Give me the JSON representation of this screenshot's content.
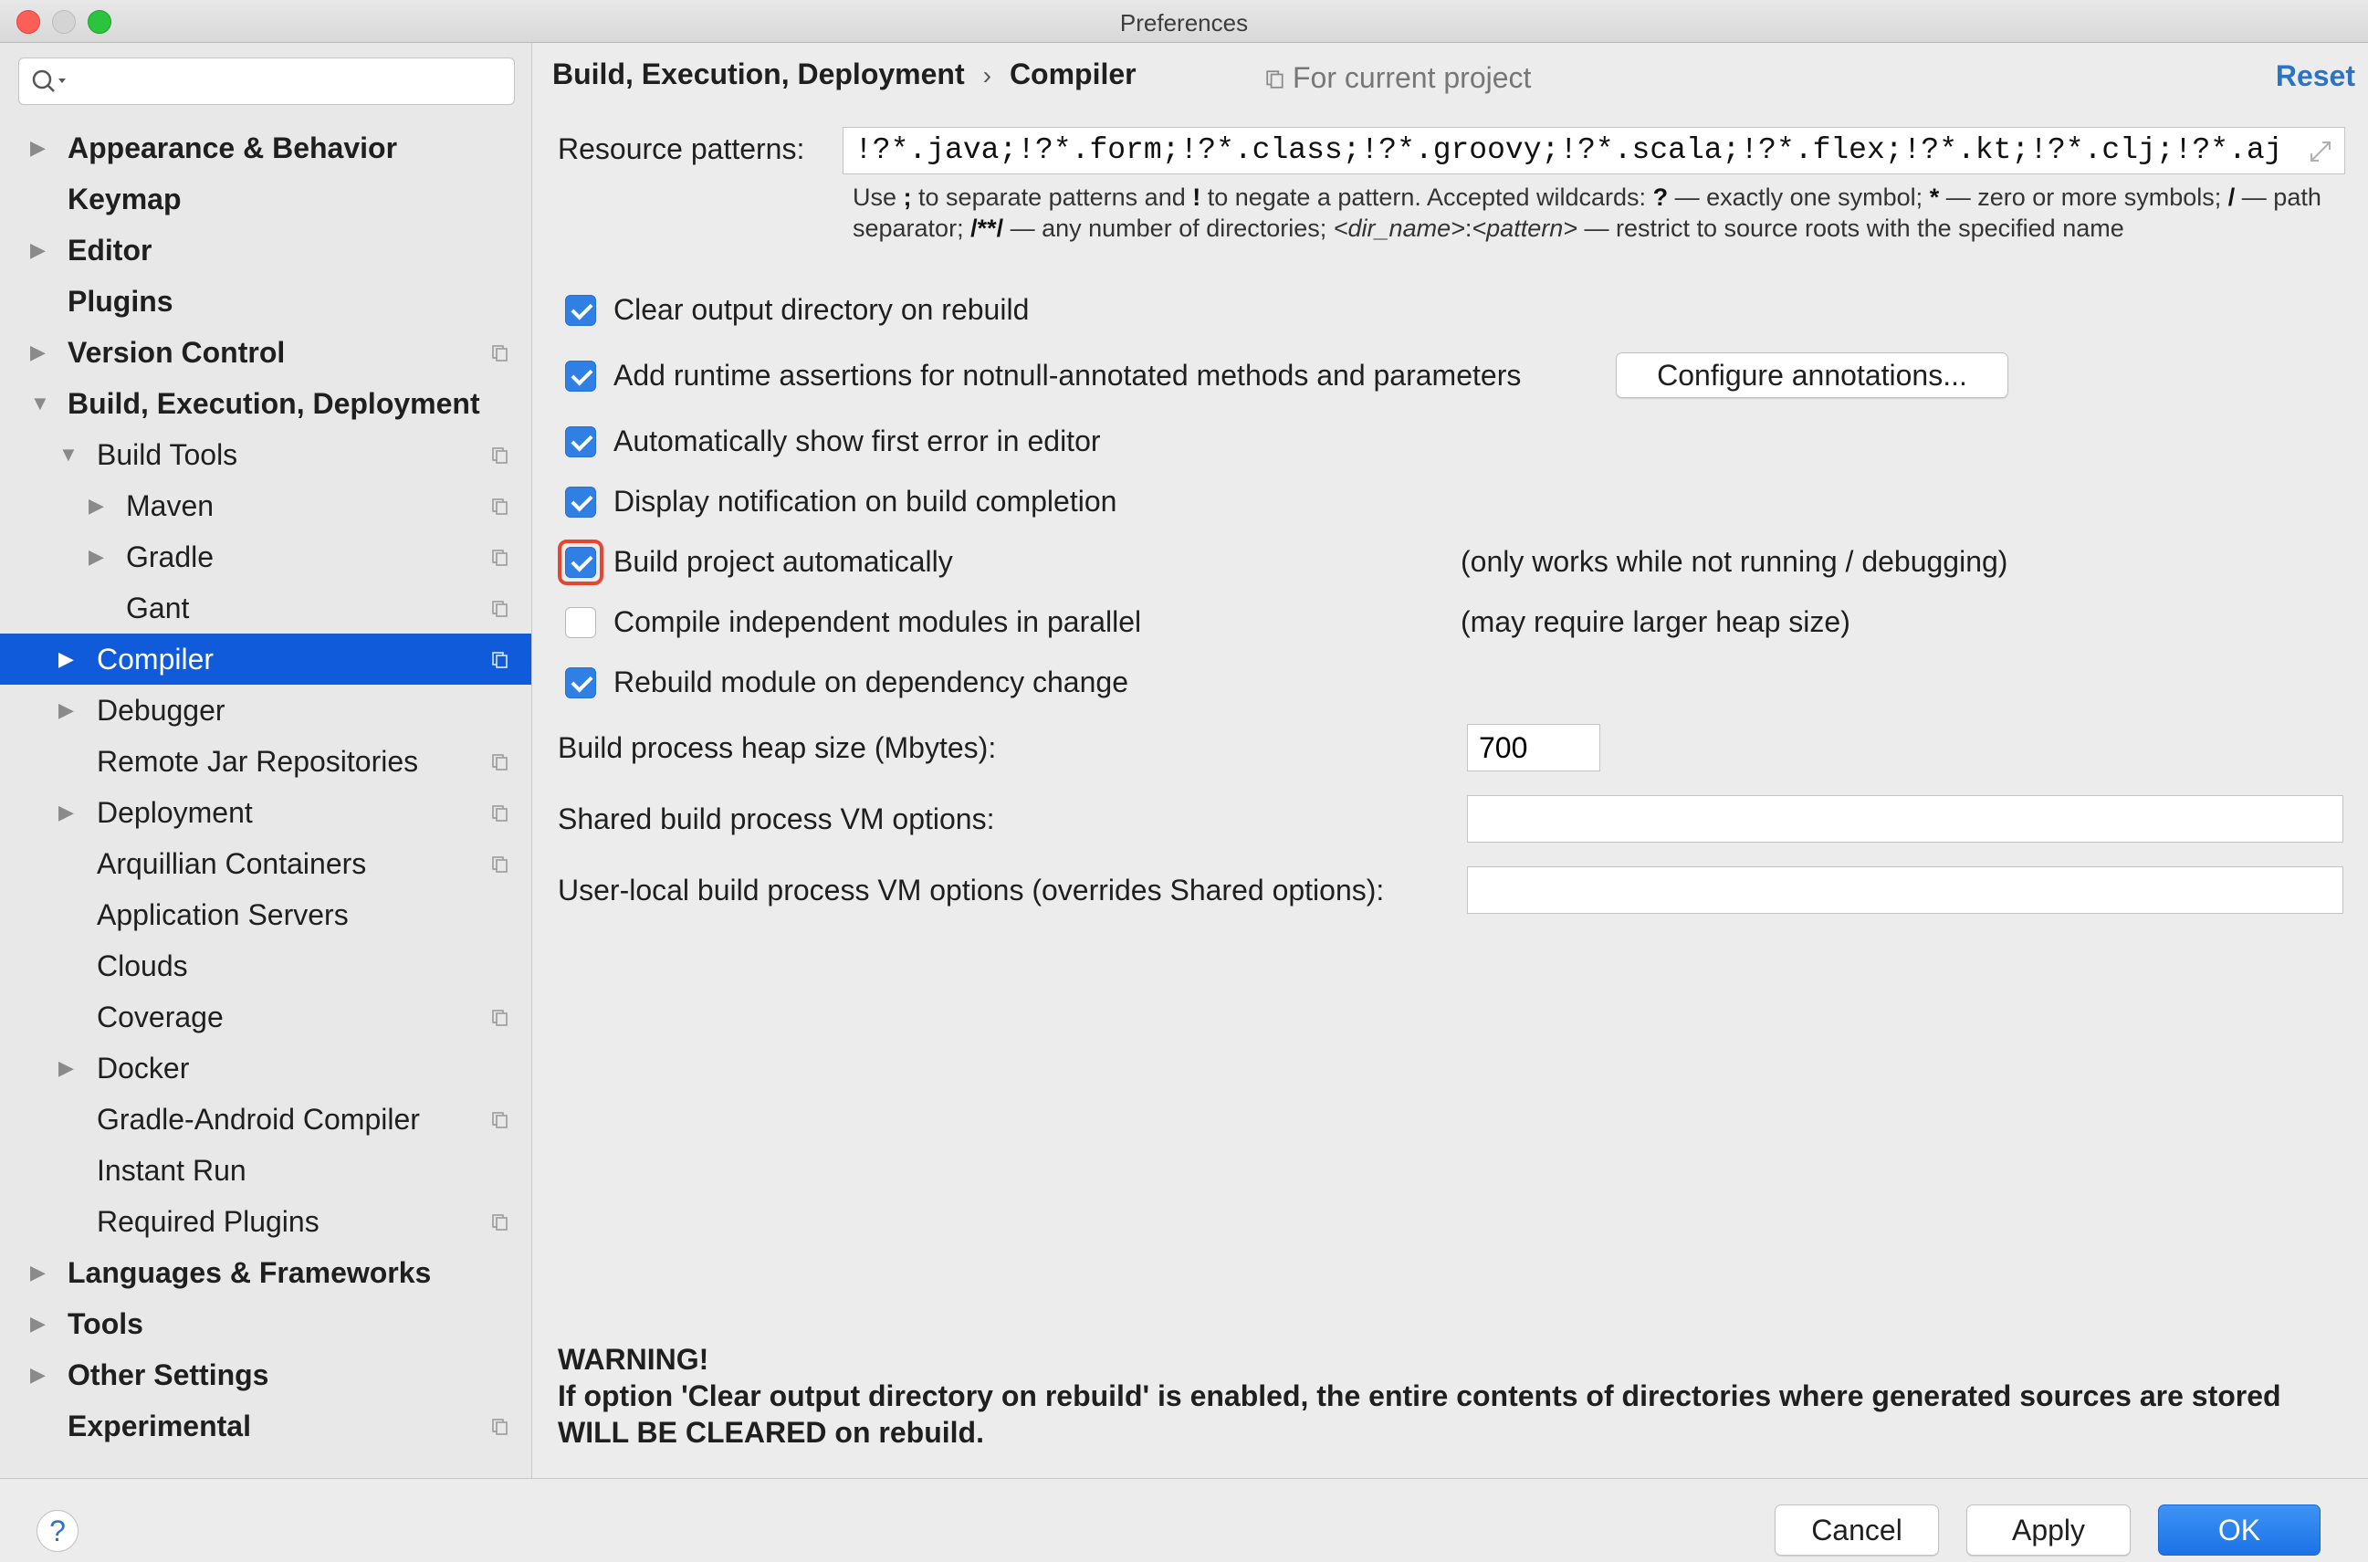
{
  "window": {
    "title": "Preferences"
  },
  "sidebar": {
    "search_placeholder": "",
    "items": [
      {
        "label": "Appearance & Behavior"
      },
      {
        "label": "Keymap"
      },
      {
        "label": "Editor"
      },
      {
        "label": "Plugins"
      },
      {
        "label": "Version Control"
      },
      {
        "label": "Build, Execution, Deployment"
      },
      {
        "label": "Build Tools"
      },
      {
        "label": "Maven"
      },
      {
        "label": "Gradle"
      },
      {
        "label": "Gant"
      },
      {
        "label": "Compiler"
      },
      {
        "label": "Debugger"
      },
      {
        "label": "Remote Jar Repositories"
      },
      {
        "label": "Deployment"
      },
      {
        "label": "Arquillian Containers"
      },
      {
        "label": "Application Servers"
      },
      {
        "label": "Clouds"
      },
      {
        "label": "Coverage"
      },
      {
        "label": "Docker"
      },
      {
        "label": "Gradle-Android Compiler"
      },
      {
        "label": "Instant Run"
      },
      {
        "label": "Required Plugins"
      },
      {
        "label": "Languages & Frameworks"
      },
      {
        "label": "Tools"
      },
      {
        "label": "Other Settings"
      },
      {
        "label": "Experimental"
      }
    ]
  },
  "header": {
    "breadcrumb_parent": "Build, Execution, Deployment",
    "breadcrumb_sep": "›",
    "breadcrumb_current": "Compiler",
    "scope": "For current project",
    "reset": "Reset"
  },
  "resource_patterns": {
    "label": "Resource patterns:",
    "value": "!?*.java;!?*.form;!?*.class;!?*.groovy;!?*.scala;!?*.flex;!?*.kt;!?*.clj;!?*.aj"
  },
  "hint": {
    "t1": "Use ",
    "b1": ";",
    "t2": " to separate patterns and ",
    "b2": "!",
    "t3": " to negate a pattern. Accepted wildcards: ",
    "b3": "?",
    "t4": " — exactly one symbol; ",
    "b4": "*",
    "t5": " — zero or more symbols; ",
    "b5": "/",
    "t6": " — path separator; ",
    "b6": "/**/",
    "t7": " — any number of directories; ",
    "i1": "<dir_name>",
    "t8": ":",
    "i2": "<pattern>",
    "t9": " — restrict to source roots with the specified name"
  },
  "options": {
    "clear_output": {
      "label": "Clear output directory on rebuild",
      "checked": true
    },
    "runtime_assertions": {
      "label": "Add runtime assertions for notnull-annotated methods and parameters",
      "checked": true
    },
    "configure_annotations": "Configure annotations...",
    "show_first_error": {
      "label": "Automatically show first error in editor",
      "checked": true
    },
    "notify_completion": {
      "label": "Display notification on build completion",
      "checked": true
    },
    "build_auto": {
      "label": "Build project automatically",
      "checked": true,
      "note": "(only works while not running / debugging)"
    },
    "parallel": {
      "label": "Compile independent modules in parallel",
      "checked": false,
      "note": "(may require larger heap size)"
    },
    "rebuild_dep": {
      "label": "Rebuild module on dependency change",
      "checked": true
    }
  },
  "fields": {
    "heap": {
      "label": "Build process heap size (Mbytes):",
      "value": "700"
    },
    "shared_vm": {
      "label": "Shared build process VM options:",
      "value": ""
    },
    "user_vm": {
      "label": "User-local build process VM options (overrides Shared options):",
      "value": ""
    }
  },
  "warning": {
    "title": "WARNING!",
    "text": "If option 'Clear output directory on rebuild' is enabled, the entire contents of directories where generated sources are stored WILL BE CLEARED on rebuild."
  },
  "footer": {
    "help": "?",
    "cancel": "Cancel",
    "apply": "Apply",
    "ok": "OK"
  },
  "colors": {
    "accent": "#0f5bd9",
    "checkbox": "#2f7fe5",
    "link": "#2a74c7",
    "focus_ring": "#e5462f"
  }
}
